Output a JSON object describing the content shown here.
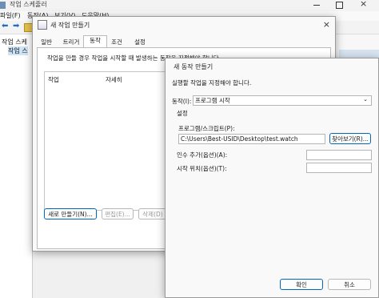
{
  "scheduler": {
    "title": "작업 스케줄러",
    "menu": [
      "파일(F)",
      "동작(A)",
      "보기(V)",
      "도움말(H)"
    ],
    "tree_items": [
      "작업 스케",
      "작업 스"
    ]
  },
  "create_task": {
    "title": "새 작업 만들기",
    "tabs": [
      "일반",
      "트리거",
      "동작",
      "조건",
      "설정"
    ],
    "description": "작업을 만들 경우 작업을 시작할 때 발생하는 동작을 지정해야 합니다.",
    "columns": [
      "작업",
      "자세히"
    ],
    "buttons": {
      "new": "새로 만들기(N)...",
      "edit": "편집(E)...",
      "delete": "삭제(D)"
    }
  },
  "new_action": {
    "title": "새 동작 만들기",
    "instruction": "실행할 작업을 지정해야 합니다.",
    "action_label": "동작(I):",
    "action_value": "프로그램 시작",
    "settings_header": "설정",
    "program_label": "프로그램/스크립트(P):",
    "program_value": "C:\\Users\\Best-USID\\Desktop\\test.watch",
    "browse_button": "찾아보기(R)...",
    "args_label": "인수 추가(옵션)(A):",
    "start_label": "시작 위치(옵션)(T):",
    "ok_button": "확인",
    "cancel_button": "취소"
  }
}
